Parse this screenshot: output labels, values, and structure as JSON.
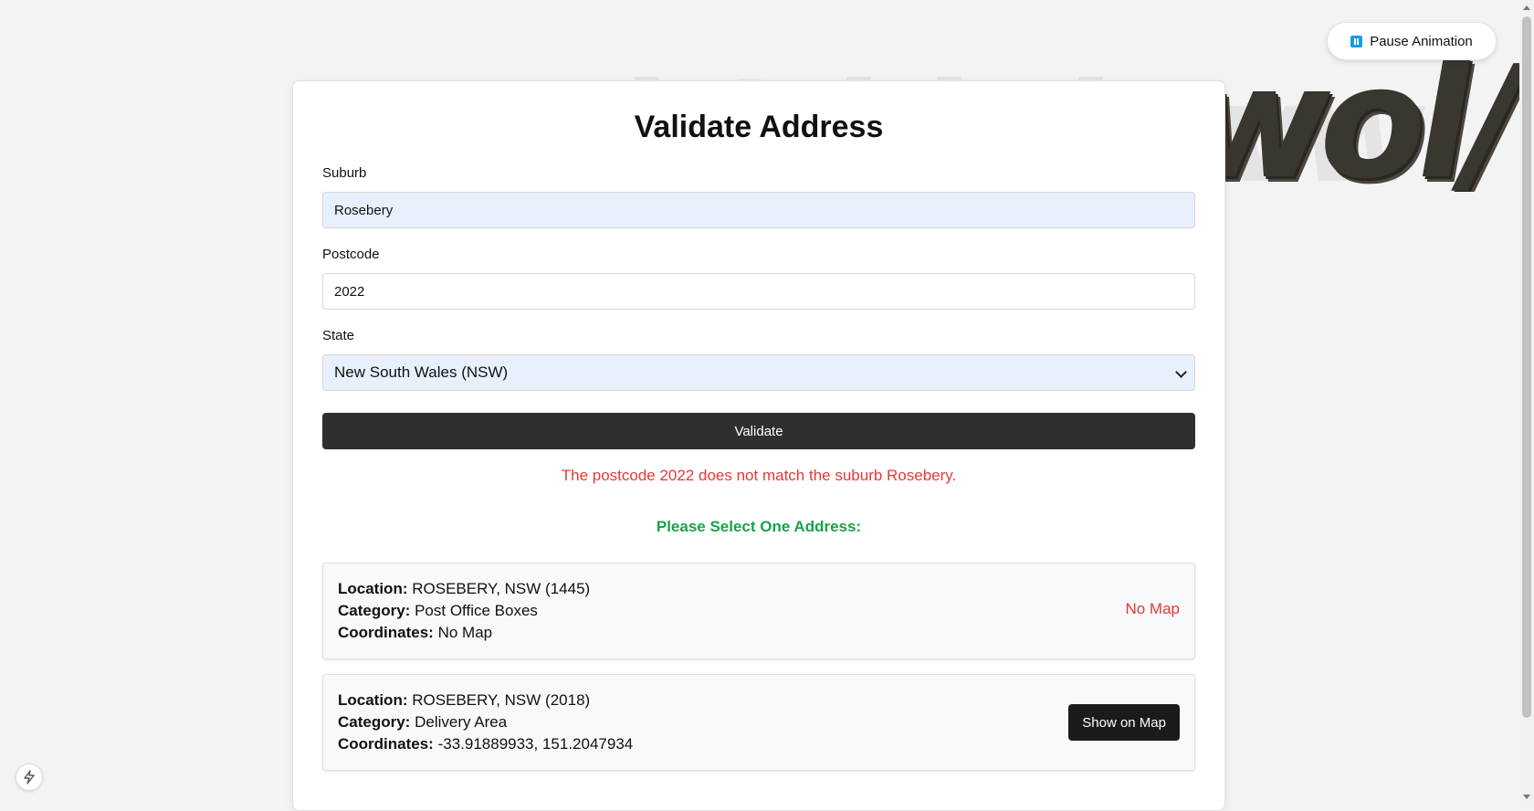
{
  "animation_toggle": {
    "label": "Pause Animation",
    "icon": "pause-icon"
  },
  "form": {
    "title": "Validate Address",
    "suburb": {
      "label": "Suburb",
      "value": "Rosebery"
    },
    "postcode": {
      "label": "Postcode",
      "value": "2022"
    },
    "state": {
      "label": "State",
      "selected": "New South Wales (NSW)"
    },
    "submit_label": "Validate"
  },
  "result": {
    "error": "The postcode 2022 does not match the suburb Rosebery.",
    "select_heading": "Please Select One Address:",
    "addresses": [
      {
        "location_label": "Location:",
        "location": "ROSEBERY, NSW (1445)",
        "category_label": "Category:",
        "category": "Post Office Boxes",
        "coordinates_label": "Coordinates:",
        "coordinates": "No Map",
        "action": "No Map"
      },
      {
        "location_label": "Location:",
        "location": "ROSEBERY, NSW (2018)",
        "category_label": "Category:",
        "category": "Delivery Area",
        "coordinates_label": "Coordinates:",
        "coordinates": "-33.91889933, 151.2047934",
        "action": "Show on Map"
      }
    ]
  },
  "colors": {
    "error": "#e53935",
    "success": "#17a34a",
    "primary_button": "#2f2f2f",
    "autofill": "#e8f0fe",
    "pause_icon": "#1a9be8"
  }
}
